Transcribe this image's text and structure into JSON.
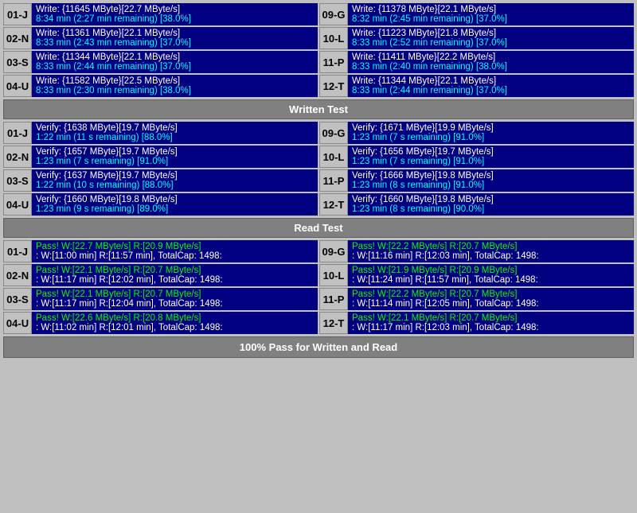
{
  "sections": {
    "write_test_label": "Written Test",
    "read_test_label": "Read Test",
    "final_label": "100% Pass for Written and Read"
  },
  "write": {
    "left": [
      {
        "id": "01-J",
        "line1": "Write: {11645 MByte}[22.7 MByte/s]",
        "line2": "8:34 min (2:27 min remaining)  [38.0%]"
      },
      {
        "id": "02-N",
        "line1": "Write: {11361 MByte}[22.1 MByte/s]",
        "line2": "8:33 min (2:43 min remaining)  [37.0%]"
      },
      {
        "id": "03-S",
        "line1": "Write: {11344 MByte}[22.1 MByte/s]",
        "line2": "8:33 min (2:44 min remaining)  [37.0%]"
      },
      {
        "id": "04-U",
        "line1": "Write: {11582 MByte}[22.5 MByte/s]",
        "line2": "8:33 min (2:30 min remaining)  [38.0%]"
      }
    ],
    "right": [
      {
        "id": "09-G",
        "line1": "Write: {11378 MByte}[22.1 MByte/s]",
        "line2": "8:32 min (2:45 min remaining)  [37.0%]"
      },
      {
        "id": "10-L",
        "line1": "Write: {11223 MByte}[21.8 MByte/s]",
        "line2": "8:33 min (2:52 min remaining)  [37.0%]"
      },
      {
        "id": "11-P",
        "line1": "Write: {11411 MByte}[22.2 MByte/s]",
        "line2": "8:33 min (2:40 min remaining)  [38.0%]"
      },
      {
        "id": "12-T",
        "line1": "Write: {11344 MByte}[22.1 MByte/s]",
        "line2": "8:33 min (2:44 min remaining)  [37.0%]"
      }
    ]
  },
  "verify": {
    "left": [
      {
        "id": "01-J",
        "line1": "Verify: {1638 MByte}[19.7 MByte/s]",
        "line2": "1:22 min (11 s remaining)  [88.0%]"
      },
      {
        "id": "02-N",
        "line1": "Verify: {1657 MByte}[19.7 MByte/s]",
        "line2": "1:23 min (7 s remaining)  [91.0%]"
      },
      {
        "id": "03-S",
        "line1": "Verify: {1637 MByte}[19.7 MByte/s]",
        "line2": "1:22 min (10 s remaining)  [88.0%]"
      },
      {
        "id": "04-U",
        "line1": "Verify: {1660 MByte}[19.8 MByte/s]",
        "line2": "1:23 min (9 s remaining)  [89.0%]"
      }
    ],
    "right": [
      {
        "id": "09-G",
        "line1": "Verify: {1671 MByte}[19.9 MByte/s]",
        "line2": "1:23 min (7 s remaining)  [91.0%]"
      },
      {
        "id": "10-L",
        "line1": "Verify: {1656 MByte}[19.7 MByte/s]",
        "line2": "1:23 min (7 s remaining)  [91.0%]"
      },
      {
        "id": "11-P",
        "line1": "Verify: {1666 MByte}[19.8 MByte/s]",
        "line2": "1:23 min (8 s remaining)  [91.0%]"
      },
      {
        "id": "12-T",
        "line1": "Verify: {1660 MByte}[19.8 MByte/s]",
        "line2": "1:23 min (8 s remaining)  [90.0%]"
      }
    ]
  },
  "read": {
    "left": [
      {
        "id": "01-J",
        "line1": "Pass! W:[22.7 MByte/s] R:[20.9 MByte/s]",
        "line2": ": W:[11:00 min] R:[11:57 min], TotalCap: 1498:"
      },
      {
        "id": "02-N",
        "line1": "Pass! W:[22.1 MByte/s] R:[20.7 MByte/s]",
        "line2": ": W:[11:17 min] R:[12:02 min], TotalCap: 1498:"
      },
      {
        "id": "03-S",
        "line1": "Pass! W:[22.1 MByte/s] R:[20.7 MByte/s]",
        "line2": ": W:[11:17 min] R:[12:04 min], TotalCap: 1498:"
      },
      {
        "id": "04-U",
        "line1": "Pass! W:[22.6 MByte/s] R:[20.8 MByte/s]",
        "line2": ": W:[11:02 min] R:[12:01 min], TotalCap: 1498:"
      }
    ],
    "right": [
      {
        "id": "09-G",
        "line1": "Pass! W:[22.2 MByte/s] R:[20.7 MByte/s]",
        "line2": ": W:[11:16 min] R:[12:03 min], TotalCap: 1498:"
      },
      {
        "id": "10-L",
        "line1": "Pass! W:[21.9 MByte/s] R:[20.9 MByte/s]",
        "line2": ": W:[11:24 min] R:[11:57 min], TotalCap: 1498:"
      },
      {
        "id": "11-P",
        "line1": "Pass! W:[22.2 MByte/s] R:[20.7 MByte/s]",
        "line2": ": W:[11:14 min] R:[12:05 min], TotalCap: 1498:"
      },
      {
        "id": "12-T",
        "line1": "Pass! W:[22.1 MByte/s] R:[20.7 MByte/s]",
        "line2": ": W:[11:17 min] R:[12:03 min], TotalCap: 1498:"
      }
    ]
  }
}
